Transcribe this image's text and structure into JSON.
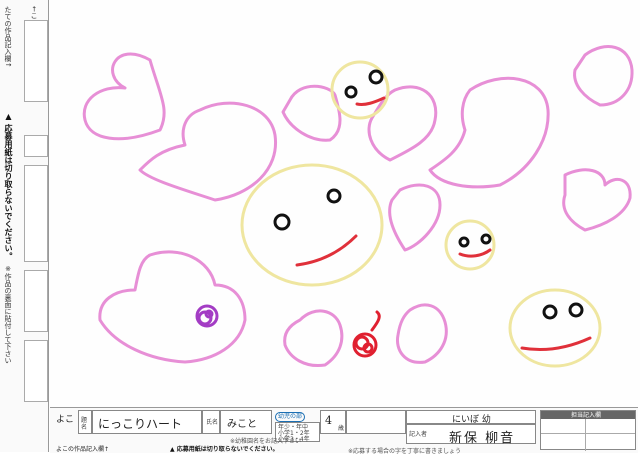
{
  "left_strip": {
    "header": "←ここ",
    "title": "たての作品記入欄↑",
    "warning": "▲ 応募用紙は切り取らないでください。",
    "note": "※作品の裏面に貼付して下さい"
  },
  "bottom_strip": {
    "arrow_label": "よこ ↓",
    "bottom_caption": "よこの作品記入欄↑",
    "warning": "▲ 応募用紙は切り取らないでください。",
    "title_label": "題名",
    "title_value": "にっこりハート",
    "name_label": "氏名",
    "name_value": "みこと",
    "age_label": "歳",
    "age_value": "4",
    "school_value": "にいぼ 幼",
    "address_value": "新保 柳音",
    "recorder_label": "記入者",
    "category_stamp": "幼児の部",
    "grade_options": [
      "年少・年中",
      "小学1・2年",
      "小学3・4年"
    ],
    "note": "※幼稚園名をお記入下さい",
    "footer_note": "※応募する場合の字を丁寧に書きましょう",
    "staff_title": "担当記入欄"
  },
  "colors": {
    "heart_pink": "#e78fd6",
    "face_yellow": "#efe6a0",
    "eye_black": "#111111",
    "mouth_red": "#e0303a",
    "purple_flower": "#a33cc4",
    "red_flower": "#e02030"
  }
}
